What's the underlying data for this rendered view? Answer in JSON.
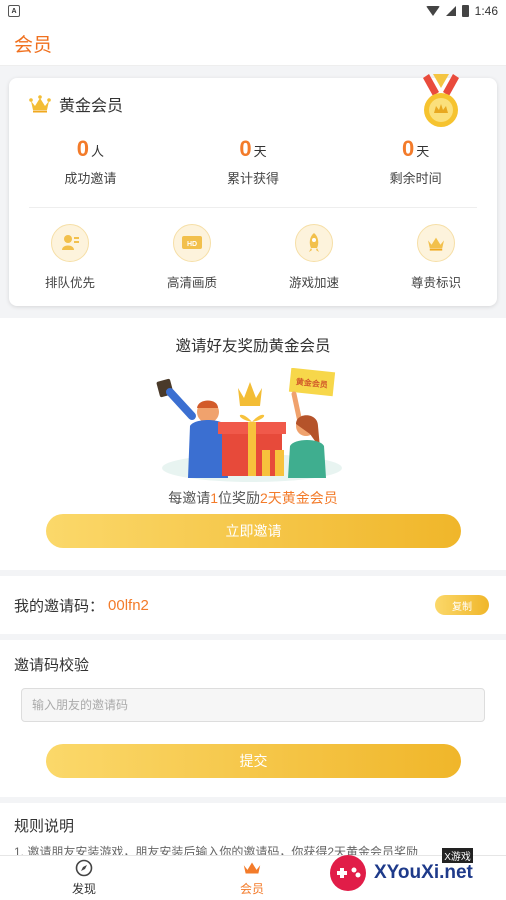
{
  "status": {
    "time": "1:46"
  },
  "header": {
    "title": "会员"
  },
  "membership": {
    "level": "黄金会员",
    "stats": [
      {
        "value": "0",
        "unit": "人",
        "label": "成功邀请"
      },
      {
        "value": "0",
        "unit": "天",
        "label": "累计获得"
      },
      {
        "value": "0",
        "unit": "天",
        "label": "剩余时间"
      }
    ],
    "perks": [
      {
        "label": "排队优先",
        "icon": "queue-priority-icon"
      },
      {
        "label": "高清画质",
        "icon": "hd-quality-icon"
      },
      {
        "label": "游戏加速",
        "icon": "rocket-icon"
      },
      {
        "label": "尊贵标识",
        "icon": "crown-icon"
      }
    ]
  },
  "invite": {
    "heading": "邀请好友奖励黄金会员",
    "banner_tag": "黄金会员",
    "desc_prefix": "每邀请",
    "desc_count": "1",
    "desc_mid": "位奖励",
    "desc_reward": "2天黄金会员",
    "button": "立即邀请"
  },
  "my_code": {
    "label": "我的邀请码：",
    "code": "00lfn2",
    "copy": "复制"
  },
  "verify": {
    "heading": "邀请码校验",
    "placeholder": "输入朋友的邀请码",
    "button": "提交"
  },
  "rules": {
    "heading": "规则说明",
    "text": "1. 邀请朋友安装游戏，朋友安装后输入你的邀请码，你获得2天黄金会员奖励"
  },
  "tabs": [
    {
      "label": "发现"
    },
    {
      "label": "会员"
    }
  ],
  "watermark": {
    "small": "X游戏",
    "big": "XYouXi.net"
  },
  "colors": {
    "accent": "#f37b2a",
    "gold": "#f0b62a"
  }
}
